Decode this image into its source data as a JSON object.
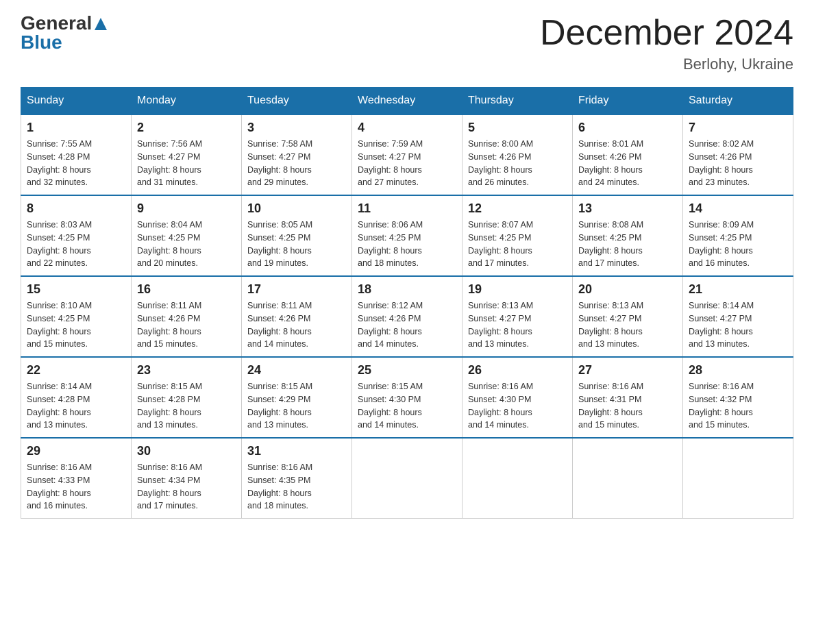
{
  "header": {
    "logo_general": "General",
    "logo_blue": "Blue",
    "month_title": "December 2024",
    "location": "Berlohy, Ukraine"
  },
  "calendar": {
    "days_of_week": [
      "Sunday",
      "Monday",
      "Tuesday",
      "Wednesday",
      "Thursday",
      "Friday",
      "Saturday"
    ],
    "weeks": [
      [
        {
          "day": "1",
          "info": "Sunrise: 7:55 AM\nSunset: 4:28 PM\nDaylight: 8 hours\nand 32 minutes."
        },
        {
          "day": "2",
          "info": "Sunrise: 7:56 AM\nSunset: 4:27 PM\nDaylight: 8 hours\nand 31 minutes."
        },
        {
          "day": "3",
          "info": "Sunrise: 7:58 AM\nSunset: 4:27 PM\nDaylight: 8 hours\nand 29 minutes."
        },
        {
          "day": "4",
          "info": "Sunrise: 7:59 AM\nSunset: 4:27 PM\nDaylight: 8 hours\nand 27 minutes."
        },
        {
          "day": "5",
          "info": "Sunrise: 8:00 AM\nSunset: 4:26 PM\nDaylight: 8 hours\nand 26 minutes."
        },
        {
          "day": "6",
          "info": "Sunrise: 8:01 AM\nSunset: 4:26 PM\nDaylight: 8 hours\nand 24 minutes."
        },
        {
          "day": "7",
          "info": "Sunrise: 8:02 AM\nSunset: 4:26 PM\nDaylight: 8 hours\nand 23 minutes."
        }
      ],
      [
        {
          "day": "8",
          "info": "Sunrise: 8:03 AM\nSunset: 4:25 PM\nDaylight: 8 hours\nand 22 minutes."
        },
        {
          "day": "9",
          "info": "Sunrise: 8:04 AM\nSunset: 4:25 PM\nDaylight: 8 hours\nand 20 minutes."
        },
        {
          "day": "10",
          "info": "Sunrise: 8:05 AM\nSunset: 4:25 PM\nDaylight: 8 hours\nand 19 minutes."
        },
        {
          "day": "11",
          "info": "Sunrise: 8:06 AM\nSunset: 4:25 PM\nDaylight: 8 hours\nand 18 minutes."
        },
        {
          "day": "12",
          "info": "Sunrise: 8:07 AM\nSunset: 4:25 PM\nDaylight: 8 hours\nand 17 minutes."
        },
        {
          "day": "13",
          "info": "Sunrise: 8:08 AM\nSunset: 4:25 PM\nDaylight: 8 hours\nand 17 minutes."
        },
        {
          "day": "14",
          "info": "Sunrise: 8:09 AM\nSunset: 4:25 PM\nDaylight: 8 hours\nand 16 minutes."
        }
      ],
      [
        {
          "day": "15",
          "info": "Sunrise: 8:10 AM\nSunset: 4:25 PM\nDaylight: 8 hours\nand 15 minutes."
        },
        {
          "day": "16",
          "info": "Sunrise: 8:11 AM\nSunset: 4:26 PM\nDaylight: 8 hours\nand 15 minutes."
        },
        {
          "day": "17",
          "info": "Sunrise: 8:11 AM\nSunset: 4:26 PM\nDaylight: 8 hours\nand 14 minutes."
        },
        {
          "day": "18",
          "info": "Sunrise: 8:12 AM\nSunset: 4:26 PM\nDaylight: 8 hours\nand 14 minutes."
        },
        {
          "day": "19",
          "info": "Sunrise: 8:13 AM\nSunset: 4:27 PM\nDaylight: 8 hours\nand 13 minutes."
        },
        {
          "day": "20",
          "info": "Sunrise: 8:13 AM\nSunset: 4:27 PM\nDaylight: 8 hours\nand 13 minutes."
        },
        {
          "day": "21",
          "info": "Sunrise: 8:14 AM\nSunset: 4:27 PM\nDaylight: 8 hours\nand 13 minutes."
        }
      ],
      [
        {
          "day": "22",
          "info": "Sunrise: 8:14 AM\nSunset: 4:28 PM\nDaylight: 8 hours\nand 13 minutes."
        },
        {
          "day": "23",
          "info": "Sunrise: 8:15 AM\nSunset: 4:28 PM\nDaylight: 8 hours\nand 13 minutes."
        },
        {
          "day": "24",
          "info": "Sunrise: 8:15 AM\nSunset: 4:29 PM\nDaylight: 8 hours\nand 13 minutes."
        },
        {
          "day": "25",
          "info": "Sunrise: 8:15 AM\nSunset: 4:30 PM\nDaylight: 8 hours\nand 14 minutes."
        },
        {
          "day": "26",
          "info": "Sunrise: 8:16 AM\nSunset: 4:30 PM\nDaylight: 8 hours\nand 14 minutes."
        },
        {
          "day": "27",
          "info": "Sunrise: 8:16 AM\nSunset: 4:31 PM\nDaylight: 8 hours\nand 15 minutes."
        },
        {
          "day": "28",
          "info": "Sunrise: 8:16 AM\nSunset: 4:32 PM\nDaylight: 8 hours\nand 15 minutes."
        }
      ],
      [
        {
          "day": "29",
          "info": "Sunrise: 8:16 AM\nSunset: 4:33 PM\nDaylight: 8 hours\nand 16 minutes."
        },
        {
          "day": "30",
          "info": "Sunrise: 8:16 AM\nSunset: 4:34 PM\nDaylight: 8 hours\nand 17 minutes."
        },
        {
          "day": "31",
          "info": "Sunrise: 8:16 AM\nSunset: 4:35 PM\nDaylight: 8 hours\nand 18 minutes."
        },
        {
          "day": "",
          "info": ""
        },
        {
          "day": "",
          "info": ""
        },
        {
          "day": "",
          "info": ""
        },
        {
          "day": "",
          "info": ""
        }
      ]
    ]
  }
}
